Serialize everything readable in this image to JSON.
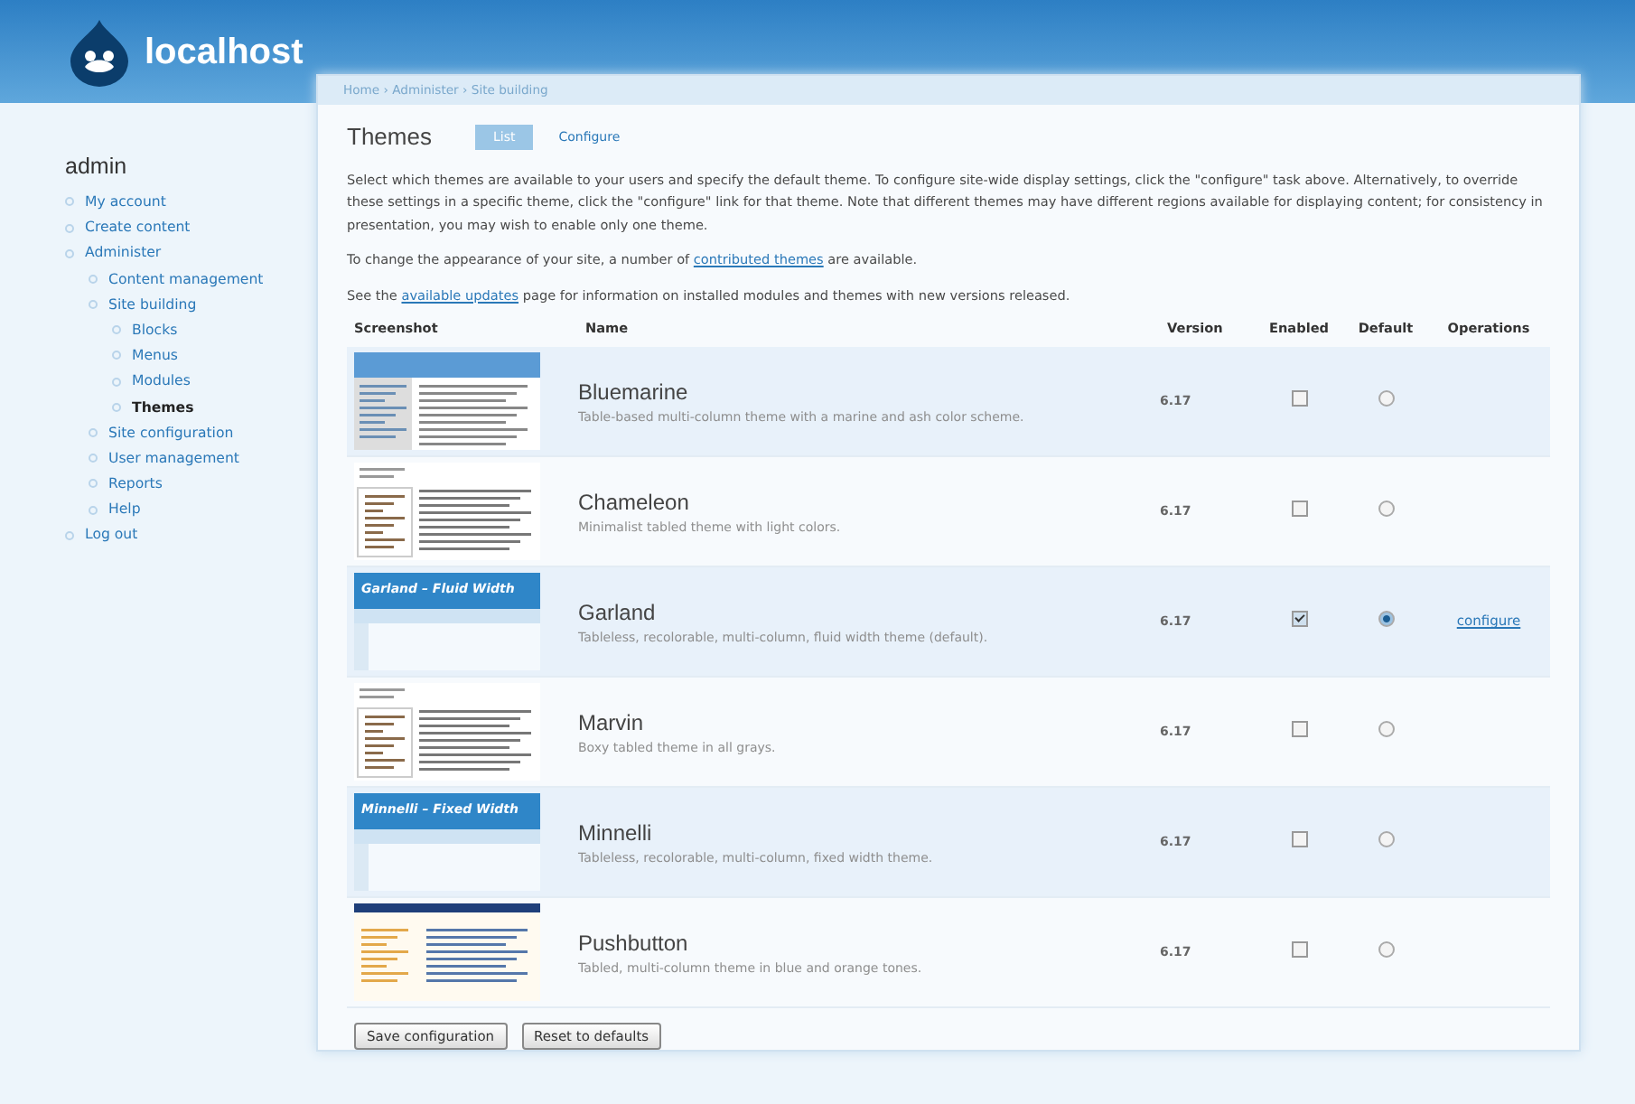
{
  "site": {
    "name": "localhost"
  },
  "sidebar": {
    "user": "admin",
    "items": [
      {
        "label": "My account",
        "active": false
      },
      {
        "label": "Create content",
        "active": false
      },
      {
        "label": "Administer",
        "active": false,
        "children": [
          {
            "label": "Content management",
            "active": false
          },
          {
            "label": "Site building",
            "active": false,
            "children": [
              {
                "label": "Blocks",
                "active": false
              },
              {
                "label": "Menus",
                "active": false
              },
              {
                "label": "Modules",
                "active": false
              },
              {
                "label": "Themes",
                "active": true
              }
            ]
          },
          {
            "label": "Site configuration",
            "active": false
          },
          {
            "label": "User management",
            "active": false
          },
          {
            "label": "Reports",
            "active": false
          },
          {
            "label": "Help",
            "active": false
          }
        ]
      },
      {
        "label": "Log out",
        "active": false
      }
    ]
  },
  "breadcrumb": "Home › Administer › Site building",
  "page": {
    "title": "Themes",
    "tabs": [
      {
        "label": "List",
        "selected": true
      },
      {
        "label": "Configure",
        "selected": false
      }
    ]
  },
  "paragraphs": [
    [
      {
        "text": "Select which themes are available to your users and specify the default theme. To configure site-wide display settings, click the \"configure\" task above. Alternatively, to override these settings in a specific theme, click the \"configure\" link for that theme. Note that different themes may have different regions available for displaying content; for consistency in presentation, you may wish to enable only one theme."
      }
    ],
    [
      {
        "text": "To change the appearance of your site, a number of "
      },
      {
        "link": "contributed themes"
      },
      {
        "text": " are available."
      }
    ],
    [
      {
        "text": "See the "
      },
      {
        "link": "available updates"
      },
      {
        "text": " page for information on installed modules and themes with new versions released."
      }
    ]
  ],
  "table": {
    "columns": [
      "Screenshot",
      "Name",
      "Version",
      "Enabled",
      "Default",
      "Operations"
    ],
    "rows": [
      {
        "thumb": {
          "kind": "blue-header"
        },
        "name": "Bluemarine",
        "description": "Table-based multi-column theme with a marine and ash color scheme.",
        "version": "6.17",
        "enabled": false,
        "default": false
      },
      {
        "thumb": {
          "kind": "plain"
        },
        "name": "Chameleon",
        "description": "Minimalist tabled theme with light colors.",
        "version": "6.17",
        "enabled": false,
        "default": false
      },
      {
        "thumb": {
          "kind": "banner",
          "title": "Garland – Fluid Width"
        },
        "name": "Garland",
        "description": "Tableless, recolorable, multi-column, fluid width theme (default).",
        "version": "6.17",
        "enabled": true,
        "default": true,
        "operation": "configure"
      },
      {
        "thumb": {
          "kind": "plain"
        },
        "name": "Marvin",
        "description": "Boxy tabled theme in all grays.",
        "version": "6.17",
        "enabled": false,
        "default": false
      },
      {
        "thumb": {
          "kind": "banner",
          "title": "Minnelli – Fixed Width"
        },
        "name": "Minnelli",
        "description": "Tableless, recolorable, multi-column, fixed width theme.",
        "version": "6.17",
        "enabled": false,
        "default": false
      },
      {
        "thumb": {
          "kind": "dark-bar"
        },
        "name": "Pushbutton",
        "description": "Tabled, multi-column theme in blue and orange tones.",
        "version": "6.17",
        "enabled": false,
        "default": false
      }
    ]
  },
  "buttons": [
    "Save configuration",
    "Reset to defaults"
  ]
}
